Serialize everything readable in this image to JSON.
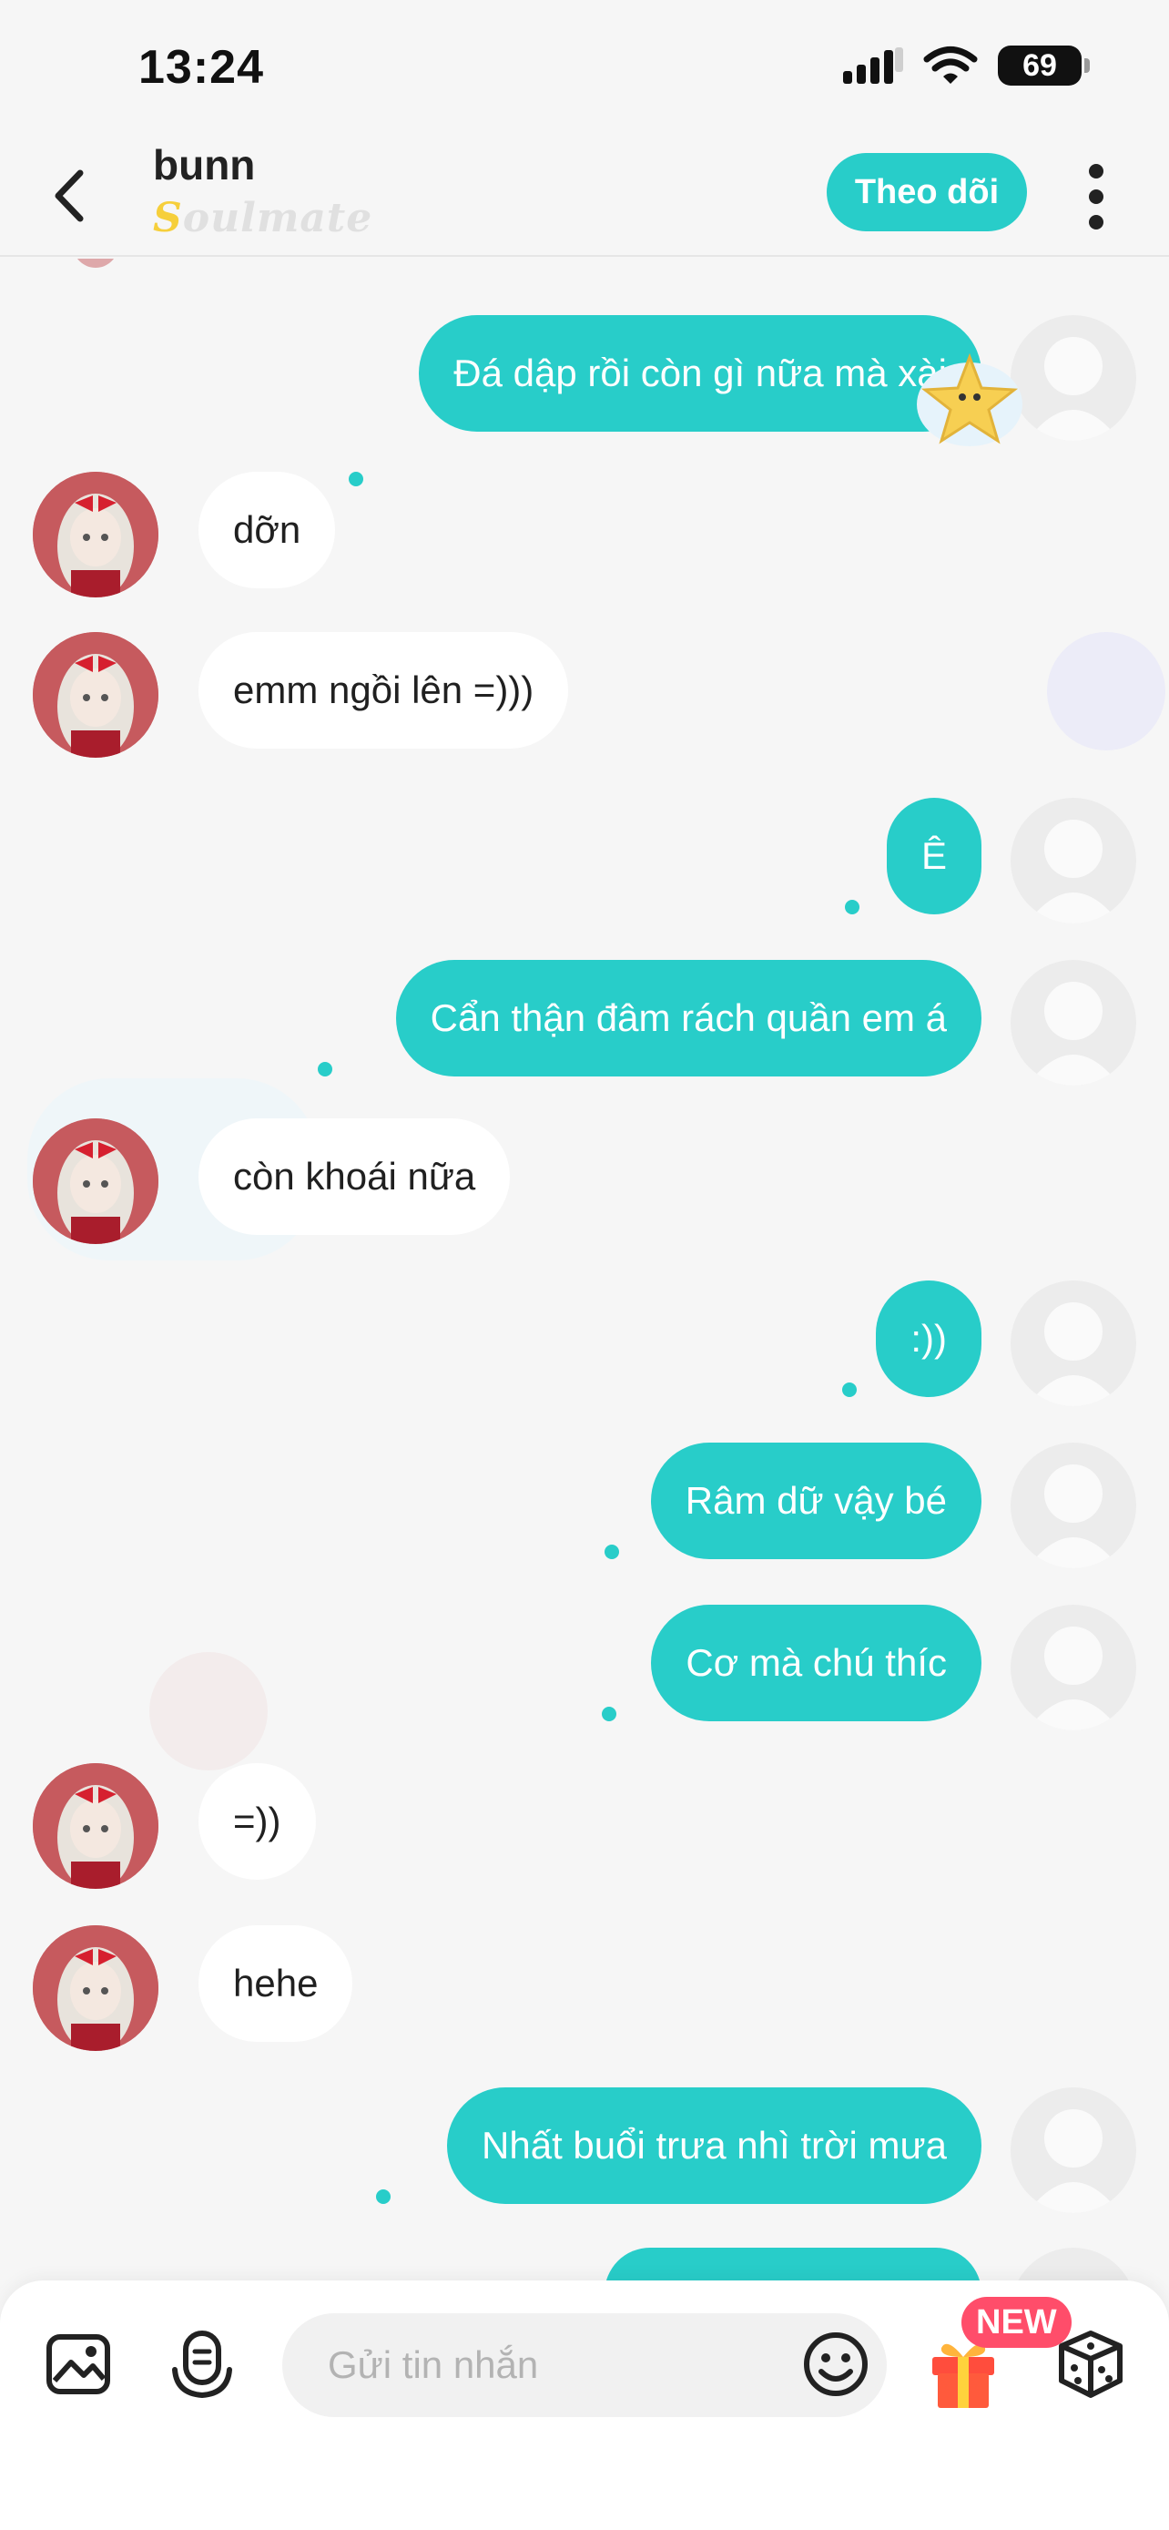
{
  "status_bar": {
    "time": "13:24",
    "battery": "69"
  },
  "header": {
    "contact_name": "bunn",
    "contact_tag_first": "S",
    "contact_tag_rest": "oulmate",
    "follow_label": "Theo dõi"
  },
  "messages": [
    {
      "from": "me",
      "text": "Đá dập rồi còn gì nữa mà xài"
    },
    {
      "from": "them",
      "text": "dỡn"
    },
    {
      "from": "them",
      "text": "emm ngồi lên =)))"
    },
    {
      "from": "me",
      "text": "Ê"
    },
    {
      "from": "me",
      "text": "Cẩn thận đâm rách quần em á"
    },
    {
      "from": "them",
      "text": "còn khoái nữa"
    },
    {
      "from": "me",
      "text": ":))"
    },
    {
      "from": "me",
      "text": "Râm dữ vậy bé"
    },
    {
      "from": "me",
      "text": "Cơ mà chú thíc"
    },
    {
      "from": "them",
      "text": "=))"
    },
    {
      "from": "them",
      "text": "hehe"
    },
    {
      "from": "me",
      "text": "Nhất buổi trưa nhì trời mưa"
    }
  ],
  "composer": {
    "placeholder": "Gửi tin nhắn",
    "new_badge": "NEW",
    "icons": [
      "image-icon",
      "voice-icon",
      "emoji-icon",
      "gift-icon",
      "dice-icon"
    ]
  },
  "colors": {
    "accent": "#28cdc9",
    "bubble_them": "#ffffff",
    "background": "#f6f6f6",
    "badge": "#ff4d6a"
  }
}
